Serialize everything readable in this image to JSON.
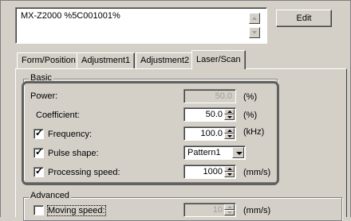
{
  "program": {
    "entry": "MX-Z2000 %5C001001%",
    "edit_label": "Edit"
  },
  "tabs": [
    {
      "label": "Form/Position"
    },
    {
      "label": "Adjustment1"
    },
    {
      "label": "Adjustment2"
    },
    {
      "label": "Laser/Scan",
      "active": true
    }
  ],
  "basic": {
    "title": "Basic",
    "power": {
      "label": "Power:",
      "value": "50.0",
      "unit": "(%)",
      "enabled": false
    },
    "coefficient": {
      "label": "Coefficient:",
      "value": "50.0",
      "unit": "(%)"
    },
    "frequency": {
      "label": "Frequency:",
      "checked": true,
      "value": "100.0",
      "unit": "(kHz)"
    },
    "pulse_shape": {
      "label": "Pulse shape:",
      "checked": true,
      "selected": "Pattern1"
    },
    "processing_speed": {
      "label": "Processing speed:",
      "checked": true,
      "value": "1000",
      "unit": "(mm/s)"
    }
  },
  "advanced": {
    "title": "Advanced",
    "moving_speed": {
      "label": "Moving speed:",
      "checked": false,
      "value": "10",
      "unit": "(mm/s)",
      "enabled": false
    }
  },
  "icons": {
    "scroll_up": "scroll-up-arrow",
    "scroll_down": "scroll-down-arrow",
    "spin": "spin-up-down-arrows",
    "dropdown": "chevron-down"
  }
}
